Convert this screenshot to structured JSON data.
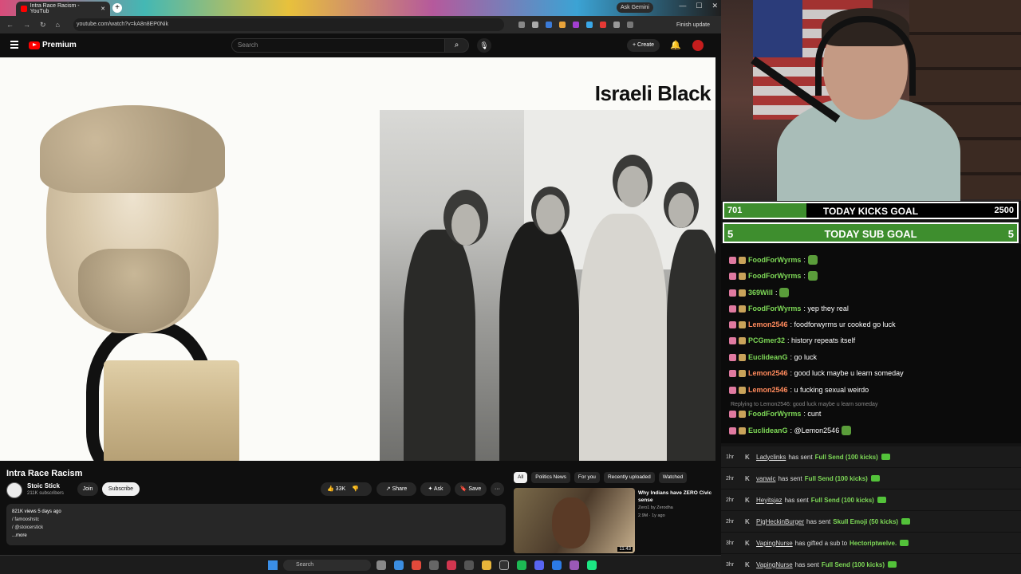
{
  "browser": {
    "tab_title": "Intra Race Racism - YouTub",
    "url": "youtube.com/watch?v=kA8n8EP0Nik",
    "ask_gemini": "Ask Gemini",
    "finish_update": "Finish update"
  },
  "yt_header": {
    "logo_text": "Premium",
    "search_placeholder": "Search",
    "create_label": "+ Create"
  },
  "video": {
    "overlay_title": "Israeli Black"
  },
  "video_info": {
    "title": "Intra Race Racism",
    "channel": "Stoic Stick",
    "subscribers": "211K subscribers",
    "join": "Join",
    "subscribe": "Subscribe",
    "likes": "33K",
    "share": "Share",
    "ask": "Ask",
    "save": "Save",
    "more": "···",
    "stats": "821K views  5 days ago",
    "link1": "/ famooshstc",
    "link2": "/ @stoicerstick",
    "more_link": "...more"
  },
  "recommended": {
    "chips": [
      "All",
      "Politics News",
      "For you",
      "Recently uploaded",
      "Watched"
    ],
    "title": "Why Indians have ZERO Civic sense",
    "channel": "Zero1 by Zerodha",
    "meta": "2.9M · 1y ago",
    "duration": "11:43"
  },
  "taskbar": {
    "search": "Search"
  },
  "stream": {
    "kicks_goal": {
      "current": "701",
      "label": "TODAY KICKS GOAL",
      "target": "2500",
      "progress": 0.28
    },
    "sub_goal": {
      "current": "5",
      "label": "TODAY SUB GOAL",
      "target": "5",
      "progress": 1.0
    },
    "chat": [
      {
        "user": "FoodForWyrms",
        "color": "#7ed957",
        "text": ":",
        "emote": true
      },
      {
        "user": "FoodForWyrms",
        "color": "#7ed957",
        "text": ":",
        "emote": true
      },
      {
        "user": "369Will",
        "color": "#7ed957",
        "text": ":",
        "emote": true
      },
      {
        "user": "FoodForWyrms",
        "color": "#7ed957",
        "text": ": yep they real",
        "emote": false
      },
      {
        "user": "Lemon2546",
        "color": "#ff8a5c",
        "text": ": foodforwyrms ur cooked go luck",
        "emote": false
      },
      {
        "user": "PCGmer32",
        "color": "#7ed957",
        "text": ": history repeats itself",
        "emote": false
      },
      {
        "user": "EuclideanG",
        "color": "#7ed957",
        "text": ": go luck",
        "emote": false
      },
      {
        "user": "Lemon2546",
        "color": "#ff8a5c",
        "text": ": good luck maybe u learn someday",
        "emote": false
      },
      {
        "user": "Lemon2546",
        "color": "#ff8a5c",
        "text": ": u fucking sexual weirdo",
        "emote": false
      },
      {
        "user": "FoodForWyrms",
        "color": "#7ed957",
        "text": ": cunt",
        "emote": false
      },
      {
        "user": "EuclideanG",
        "color": "#7ed957",
        "text": ": @Lemon2546",
        "emote": true
      }
    ],
    "reply_note": "Replying to Lemon2546: good luck maybe u learn someday",
    "events": [
      {
        "time": "1hr",
        "user": "Ladyclinks",
        "text": "has sent",
        "highlight": "Full Send (100 kicks)"
      },
      {
        "time": "2hr",
        "user": "vanwic",
        "text": "has sent",
        "highlight": "Full Send (100 kicks)"
      },
      {
        "time": "2hr",
        "user": "Heyitsjaz",
        "text": "has sent",
        "highlight": "Full Send (100 kicks)"
      },
      {
        "time": "2hr",
        "user": "PigHeckinBurger",
        "text": "has sent",
        "highlight": "Skull Emoji (50 kicks)"
      },
      {
        "time": "3hr",
        "user": "VapingNurse",
        "text": "has gifted a sub to",
        "highlight": "Hectoriptwelve."
      },
      {
        "time": "3hr",
        "user": "VapingNurse",
        "text": "has sent",
        "highlight": "Full Send (100 kicks)"
      }
    ]
  }
}
